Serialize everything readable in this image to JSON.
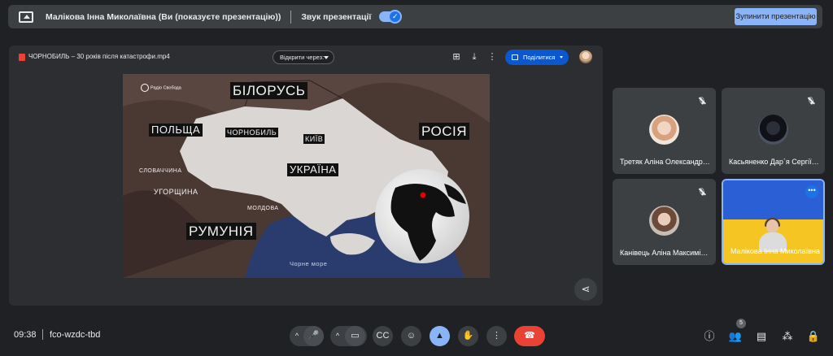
{
  "top_bar": {
    "presenter_text": "Малікова Інна Миколаївна (Ви (показуєте презентацію))",
    "audio_label": "Звук презентації",
    "audio_enabled": true,
    "stop_button_label": "Зупинити презентацію"
  },
  "video_viewer": {
    "file_name": "ЧОРНОБИЛЬ – 30 років після катастрофи.mp4",
    "open_with_label": "Відкрити через",
    "share_label": "Поділитися",
    "logo_text": "Радіо Свобода",
    "map": {
      "labels_large": [
        "БІЛОРУСЬ",
        "РОСІЯ",
        "РУМУНІЯ"
      ],
      "labels_medium": [
        "ПОЛЬЩА",
        "ЧОРНОБИЛЬ",
        "КИЇВ",
        "УКРАЇНА"
      ],
      "labels_small": [
        "СЛОВАЧЧИНА",
        "УГОРЩИНА",
        "МОЛДОВА"
      ],
      "sea_label": "Чорне море"
    }
  },
  "participants": [
    {
      "name": "Третяк Аліна Олександрівна",
      "muted": true
    },
    {
      "name": "Касьяненко Дар`я Сергіївна",
      "muted": true
    },
    {
      "name": "Канівець Аліна Максимівна",
      "muted": true
    },
    {
      "name": "Малікова Інна Миколаївна",
      "muted": false,
      "speaking": true
    }
  ],
  "bottom_bar": {
    "time": "09:38",
    "meeting_code": "fco-wzdc-tbd",
    "participant_count": "5"
  },
  "colors": {
    "background": "#202124",
    "accent": "#8ab4f8",
    "leave": "#ea4335",
    "drive_blue": "#0b57d0"
  }
}
